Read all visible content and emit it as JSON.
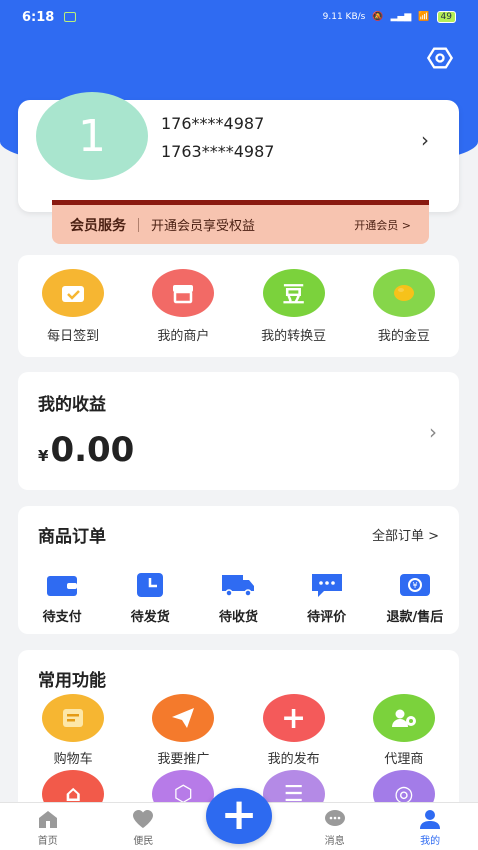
{
  "status_bar": {
    "time": "6:18",
    "speed": "9.11 KB/s",
    "battery": "49"
  },
  "profile": {
    "avatar_text": "1",
    "line1": "176****4987",
    "line2": "1763****4987"
  },
  "membership": {
    "title": "会员服务",
    "desc": "开通会员享受权益",
    "link": "开通会员 >"
  },
  "quick_actions": [
    {
      "label": "每日签到",
      "color": "#f6b632"
    },
    {
      "label": "我的商户",
      "color": "#f26a66"
    },
    {
      "label": "我的转换豆",
      "glyph": "豆",
      "color": "#7bd23c"
    },
    {
      "label": "我的金豆",
      "color": "#86d64a"
    }
  ],
  "earnings": {
    "title": "我的收益",
    "currency": "¥",
    "amount": "0.00"
  },
  "orders": {
    "title": "商品订单",
    "all_link": "全部订单 >",
    "items": [
      {
        "label": "待支付",
        "icon": "wallet-icon"
      },
      {
        "label": "待发货",
        "icon": "box-icon"
      },
      {
        "label": "待收货",
        "icon": "truck-icon"
      },
      {
        "label": "待评价",
        "icon": "comment-icon"
      },
      {
        "label": "退款/售后",
        "icon": "refund-icon"
      }
    ]
  },
  "functions": {
    "title": "常用功能",
    "items": [
      {
        "label": "购物车",
        "color": "#f6b632"
      },
      {
        "label": "我要推广",
        "color": "#f47a2c"
      },
      {
        "label": "我的发布",
        "color": "#f45a5a"
      },
      {
        "label": "代理商",
        "color": "#7bd23c"
      }
    ],
    "row2_colors": [
      "#f25a4a",
      "#b77be8",
      "#b48ae6",
      "#a37ce8"
    ]
  },
  "tabbar": [
    {
      "label": "首页",
      "icon": "home-icon"
    },
    {
      "label": "便民",
      "icon": "heart-icon"
    },
    {
      "label": "",
      "icon": "plus-icon"
    },
    {
      "label": "消息",
      "icon": "message-icon"
    },
    {
      "label": "我的",
      "icon": "user-icon"
    }
  ],
  "colors": {
    "primary": "#2f6bf2",
    "member_band": "#f7c4b0"
  }
}
